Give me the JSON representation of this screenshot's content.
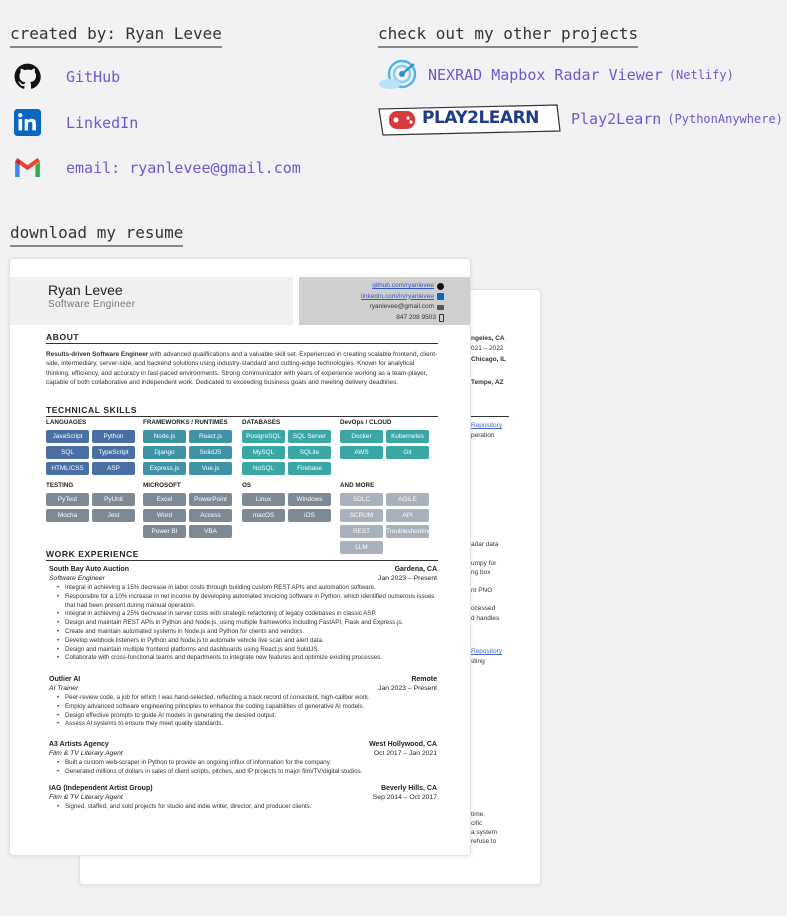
{
  "links": {
    "title": "created by: Ryan Levee",
    "items": [
      {
        "label": "GitHub",
        "icon": "github-icon"
      },
      {
        "label": "LinkedIn",
        "icon": "linkedin-icon"
      },
      {
        "label": "email: ryanlevee@gmail.com",
        "icon": "gmail-icon"
      }
    ]
  },
  "projects": {
    "title": "check out my other projects",
    "items": [
      {
        "label": "NEXRAD Mapbox Radar Viewer",
        "host": "(Netlify)",
        "icon": "radar-logo-icon"
      },
      {
        "label": "Play2Learn",
        "host": "(PythonAnywhere)",
        "logo_text": "PLAY2LEARN",
        "icon": "play2learn-logo-icon"
      }
    ]
  },
  "resume": {
    "title": "download my resume",
    "name": "Ryan Levee",
    "role": "Software Engineer",
    "contact": [
      "github.com/ryanlevee",
      "linkedin.com/in/ryanlevee",
      "ryanlevee@gmail.com",
      "847 208 9503"
    ],
    "sections": {
      "about": "ABOUT",
      "skills": "TECHNICAL SKILLS",
      "work": "WORK EXPERIENCE"
    },
    "about_bold": "Results-driven Software Engineer",
    "about_text": " with advanced qualifications and a valuable skill set. Experienced in creating scalable frontend, client-side, intermediary, server-side, and backend solutions using industry-standard and cutting-edge technologies. Known for analytical thinking, efficiency, and accuracy in fast-paced environments. Strong communicator with years of experience working as a team-player, capable of both collaborative and independent work. Dedicated to exceeding business goals and meeting delivery deadlines.",
    "skills": {
      "languages": {
        "head": "LANGUAGES",
        "chips": [
          "JavaScript",
          "Python",
          "SQL",
          "TypeScript",
          "HTML/CSS",
          "ASP"
        ]
      },
      "frameworks": {
        "head": "FRAMEWORKS / RUNTIMES",
        "chips": [
          "Node.js",
          "React.js",
          "Django",
          "SolidJS",
          "Express.js",
          "Vue.js"
        ]
      },
      "databases": {
        "head": "DATABASES",
        "chips": [
          "PostgreSQL",
          "SQL Server",
          "MySQL",
          "SQLite",
          "NoSQL",
          "Firebase"
        ]
      },
      "devops": {
        "head": "DevOps / CLOUD",
        "chips": [
          "Docker",
          "Kubernetes",
          "AWS",
          "Git"
        ]
      },
      "testing": {
        "head": "TESTING",
        "chips": [
          "PyTest",
          "PyUnit",
          "Mocha",
          "Jest"
        ]
      },
      "microsoft": {
        "head": "MICROSOFT",
        "chips": [
          "Excel",
          "PowerPoint",
          "Word",
          "Access",
          "Power BI",
          "VBA"
        ]
      },
      "os": {
        "head": "OS",
        "chips": [
          "Linux",
          "Windows",
          "macOS",
          "iOS"
        ]
      },
      "more": {
        "head": "AND MORE",
        "chips": [
          "SDLC",
          "AGILE",
          "SCRUM",
          "API",
          "REST",
          "Troubleshooting",
          "LLM"
        ]
      }
    },
    "colors": {
      "blue": "#4a6fa5",
      "teal": "#3f93a6",
      "aqua": "#3aa6a6",
      "gray": "#7d8a96",
      "light": "#a8b0bb"
    },
    "jobs": [
      {
        "company": "South Bay Auto Auction",
        "location": "Gardena, CA",
        "title": "Software Engineer",
        "date": "Jan 2023 – Present",
        "bullets": [
          "Integral in achieving a 15% decrease in labor costs through building custom REST APIs and automation software.",
          "Responsible for a 10% increase in net income by developing automated invoicing software in Python, which identified numerous issues that had been present during manual operation.",
          "Integral in achieving a 25% decrease in server costs with strategic refactoring of legacy codebases in classic ASP.",
          "Design and maintain REST APIs in Python and Node.js, using multiple frameworks including FastAPI, Flask and Express.js.",
          "Create and maintain automated systems in Node.js and Python for clients and vendors.",
          "Develop webhook listeners in Python and Node.js to automate vehicle live scan and alert data.",
          "Design and maintain multiple frontend platforms and dashboards using React.js and SolidJS.",
          "Collaborate with cross-functional teams and departments to integrate new features and optimize existing processes."
        ]
      },
      {
        "company": "Outlier AI",
        "location": "Remote",
        "title": "AI Trainer",
        "date": "Jan 2023 – Present",
        "bullets": [
          "Peer-review code, a job for which I was hand-selected, reflecting a track record of consistent, high-caliber work.",
          "Employ advanced software engineering principles to enhance the coding capabilities of generative AI models.",
          "Design effective prompts to guide AI models in generating the desired output.",
          "Assess AI systems to ensure they meet quality standards."
        ]
      },
      {
        "company": "A3 Artists Agency",
        "location": "West Hollywood, CA",
        "title": "Film & TV Literary Agent",
        "date": "Oct 2017 – Jan 2021",
        "bullets": [
          "Built a custom web-scraper in Python to provide an ongoing influx of information for the company.",
          "Generated millions of dollars in sales of client scripts, pitches, and IP projects to major film/TV/digital studios."
        ]
      },
      {
        "company": "IAG (Independent Artist Group)",
        "location": "Beverly Hills, CA",
        "title": "Film & TV Literary Agent",
        "date": "Sep 2014 – Oct 2017",
        "bullets": [
          "Signed, staffed, and sold projects for studio and indie writer, director, and producer clients."
        ]
      }
    ],
    "back_page": {
      "snips": [
        "ngeles, CA",
        "021 – 2022",
        "Chicago, IL",
        "Tempe, AZ",
        "Repository",
        "peration",
        "adar data",
        "umpy for",
        "ng box",
        "nt PNG",
        "ocessed",
        "d handles",
        "Repository",
        "sting",
        "time.",
        "cific",
        "a system",
        "refuse to"
      ]
    }
  }
}
